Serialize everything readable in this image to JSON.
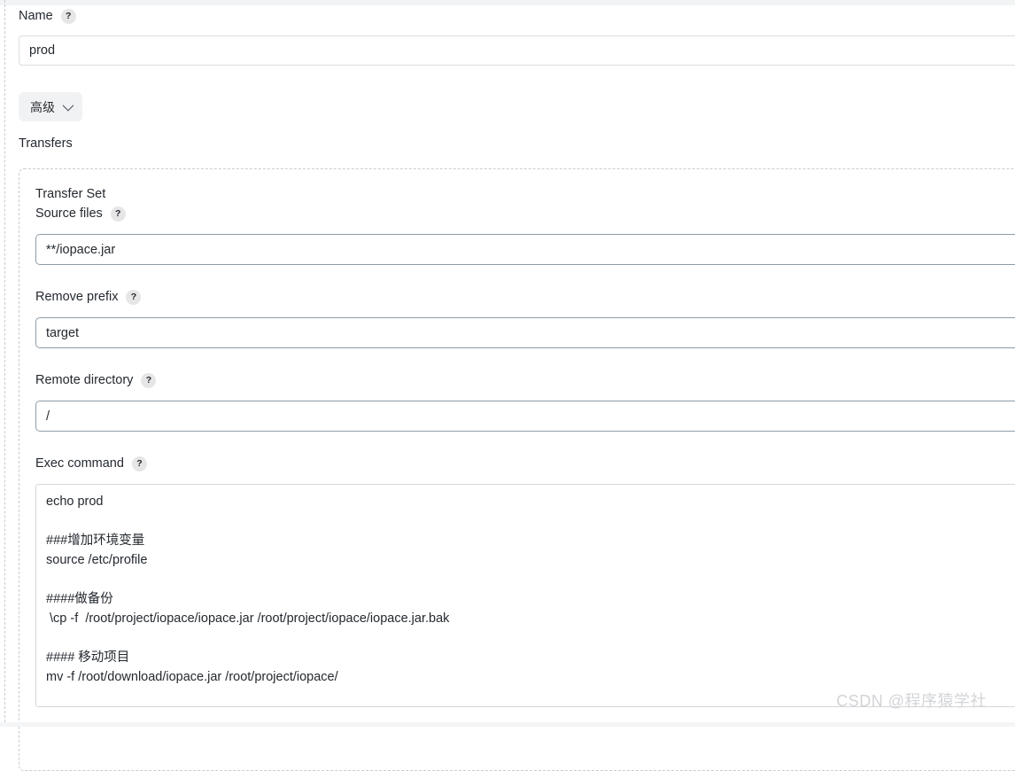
{
  "form": {
    "name": {
      "label": "Name",
      "help_icon": "question-mark-icon",
      "help_glyph": "?",
      "value": "prod",
      "placeholder": "Name"
    },
    "advanced_button": {
      "label": "高级",
      "icon": "chevron-down-icon"
    },
    "transfers": {
      "heading": "Transfers",
      "transfer_set": {
        "title": "Transfer Set",
        "remove_icon": "close-x-icon",
        "source_files": {
          "label": "Source files",
          "help_glyph": "?",
          "value": "**/iopace.jar",
          "placeholder": "Source files"
        },
        "remove_prefix": {
          "label": "Remove prefix",
          "help_glyph": "?",
          "value": "target",
          "placeholder": "Remove prefix"
        },
        "remote_directory": {
          "label": "Remote directory",
          "help_glyph": "?",
          "value": "/",
          "placeholder": "Remote directory"
        },
        "exec_command": {
          "label": "Exec command",
          "help_glyph": "?",
          "value": "echo prod\n\n###增加环境变量\nsource /etc/profile\n\n####做备份\n \\cp -f  /root/project/iopace/iopace.jar /root/project/iopace/iopace.jar.bak\n\n#### 移动项目\nmv -f /root/download/iopace.jar /root/project/iopace/\n\n###启动脚本\nsh /root/iopace.sh restart",
          "placeholder": "Exec command"
        }
      }
    }
  },
  "watermark": {
    "text": "CSDN @程序猿学社"
  },
  "colors": {
    "accent_danger": "#e8384f",
    "danger_bg": "#fdeef0",
    "input_border_focus": "#8d9ca8",
    "input_border": "#d9dde1",
    "dashed_border": "#c7ccd1"
  }
}
